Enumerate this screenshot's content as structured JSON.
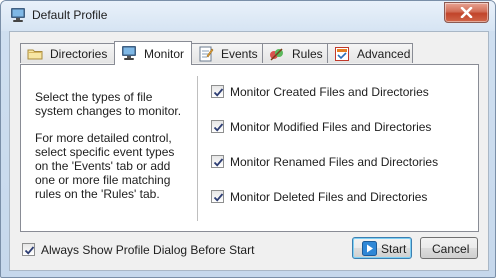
{
  "window": {
    "title": "Default Profile"
  },
  "tabs": [
    {
      "label": "Directories",
      "icon": "folder-icon"
    },
    {
      "label": "Monitor",
      "icon": "monitor-icon",
      "active": true
    },
    {
      "label": "Events",
      "icon": "events-icon"
    },
    {
      "label": "Rules",
      "icon": "rules-icon"
    },
    {
      "label": "Advanced",
      "icon": "advanced-icon"
    }
  ],
  "monitor": {
    "description_1": "Select the types of file system changes to monitor.",
    "description_2": "For more detailed control, select specific event types on the 'Events' tab or add one or more file matching rules on the 'Rules' tab.",
    "options": [
      {
        "label": "Monitor Created Files and Directories",
        "checked": true
      },
      {
        "label": "Monitor Modified Files and Directories",
        "checked": true
      },
      {
        "label": "Monitor Renamed Files and Directories",
        "checked": true
      },
      {
        "label": "Monitor Deleted Files and Directories",
        "checked": true
      }
    ]
  },
  "footer": {
    "always_show_label": "Always Show Profile Dialog Before Start",
    "always_show_checked": true,
    "start_label": "Start",
    "cancel_label": "Cancel"
  },
  "colors": {
    "accent": "#3c7fb1",
    "check": "#2d3d73"
  }
}
